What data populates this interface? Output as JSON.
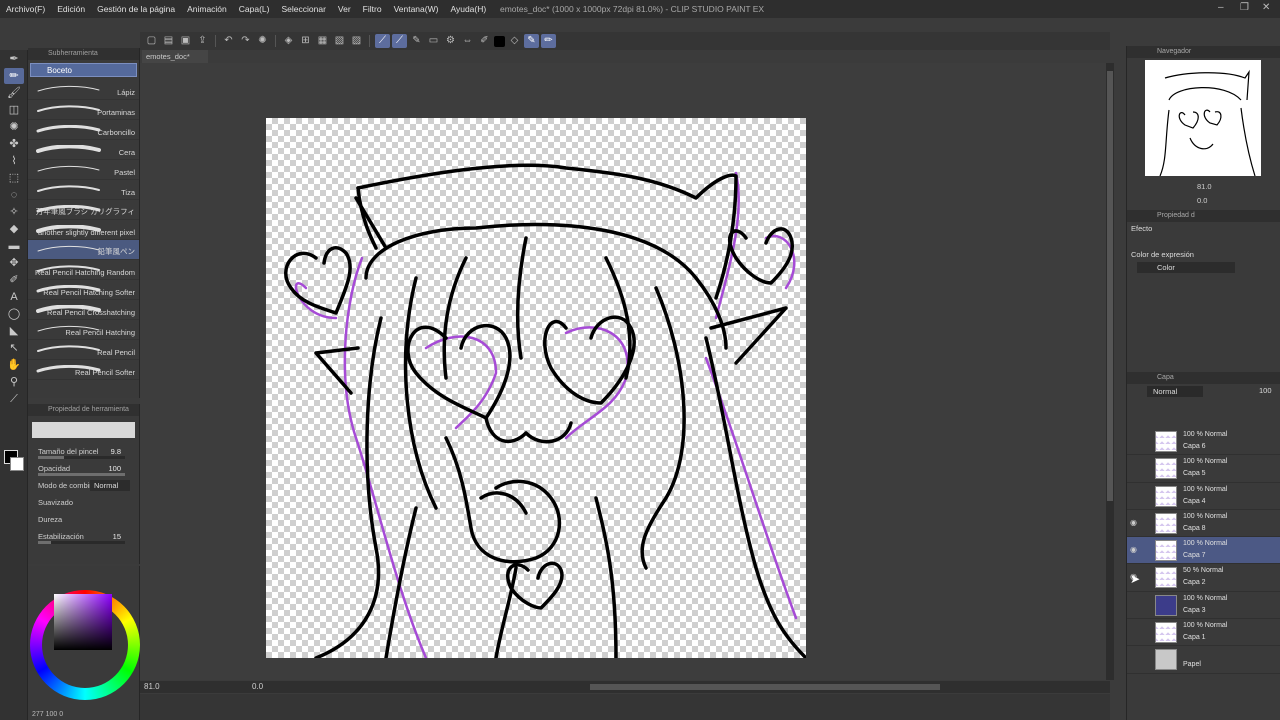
{
  "window": {
    "title": "emotes_doc* (1000 x 1000px 72dpi 81.0%) - CLIP STUDIO PAINT EX"
  },
  "menu": [
    "Archivo(F)",
    "Edición",
    "Gestión de la página",
    "Animación",
    "Capa(L)",
    "Seleccionar",
    "Ver",
    "Filtro",
    "Ventana(W)",
    "Ayuda(H)"
  ],
  "subtool": {
    "header": "Subherramienta",
    "group": "Boceto",
    "brushes": [
      "Lápiz",
      "Portaminas",
      "Carboncillo",
      "Cera",
      "Pastel",
      "Tiza",
      "万年筆風ブラシ カリグラフィ",
      "another slightly different pixel",
      "鉛筆風ペン",
      "Real Pencil Hatching Random",
      "Real Pencil Hatching Softer",
      "Real Pencil Crosshatching",
      "Real Pencil Hatching",
      "Real Pencil",
      "Real Pencil Softer"
    ],
    "selected_index": 8
  },
  "tool_property": {
    "header": "Propiedad de herramienta",
    "brush_size_label": "Tamaño del pincel",
    "brush_size_value": "9.8",
    "opacity_label": "Opacidad",
    "opacity_value": "100",
    "blend_label": "Modo de combin.",
    "blend_value": "Normal",
    "smoothing_label": "Suavizado",
    "hardness_label": "Dureza",
    "stabilization_label": "Estabilización",
    "stabilization_value": "15"
  },
  "color": {
    "stats": "277 100 0"
  },
  "canvas": {
    "tab_label": "emotes_doc*",
    "zoom": "81.0",
    "angle": "0.0"
  },
  "navigator": {
    "header": "Navegador",
    "zoom": "81.0",
    "angle": "0.0"
  },
  "layer_property": {
    "header": "Propiedad d",
    "effect_label": "Efecto",
    "color_expression_label": "Color de expresión",
    "color_expression_value": "Color"
  },
  "layer_panel": {
    "header": "Capa",
    "blend_mode": "Normal",
    "opacity": "100"
  },
  "layers": [
    {
      "mode": "100 % Normal",
      "name": "Capa 6",
      "visible": false,
      "selected": false,
      "thumb": "light"
    },
    {
      "mode": "100 % Normal",
      "name": "Capa 5",
      "visible": false,
      "selected": false,
      "thumb": "light"
    },
    {
      "mode": "100 % Normal",
      "name": "Capa 4",
      "visible": false,
      "selected": false,
      "thumb": "light"
    },
    {
      "mode": "100 % Normal",
      "name": "Capa 8",
      "visible": true,
      "selected": false,
      "thumb": "light"
    },
    {
      "mode": "100 % Normal",
      "name": "Capa 7",
      "visible": true,
      "selected": true,
      "thumb": "light"
    },
    {
      "mode": "50 % Normal",
      "name": "Capa 2",
      "visible": true,
      "selected": false,
      "thumb": "light"
    },
    {
      "mode": "100 % Normal",
      "name": "Capa 3",
      "visible": false,
      "selected": false,
      "thumb": "dark"
    },
    {
      "mode": "100 % Normal",
      "name": "Capa 1",
      "visible": false,
      "selected": false,
      "thumb": "light"
    },
    {
      "mode": "",
      "name": "Papel",
      "visible": false,
      "selected": false,
      "thumb": "paper"
    }
  ],
  "colors": {
    "accent": "#586a9a",
    "sketch_purple": "#a64bd6",
    "lineart": "#000000"
  }
}
